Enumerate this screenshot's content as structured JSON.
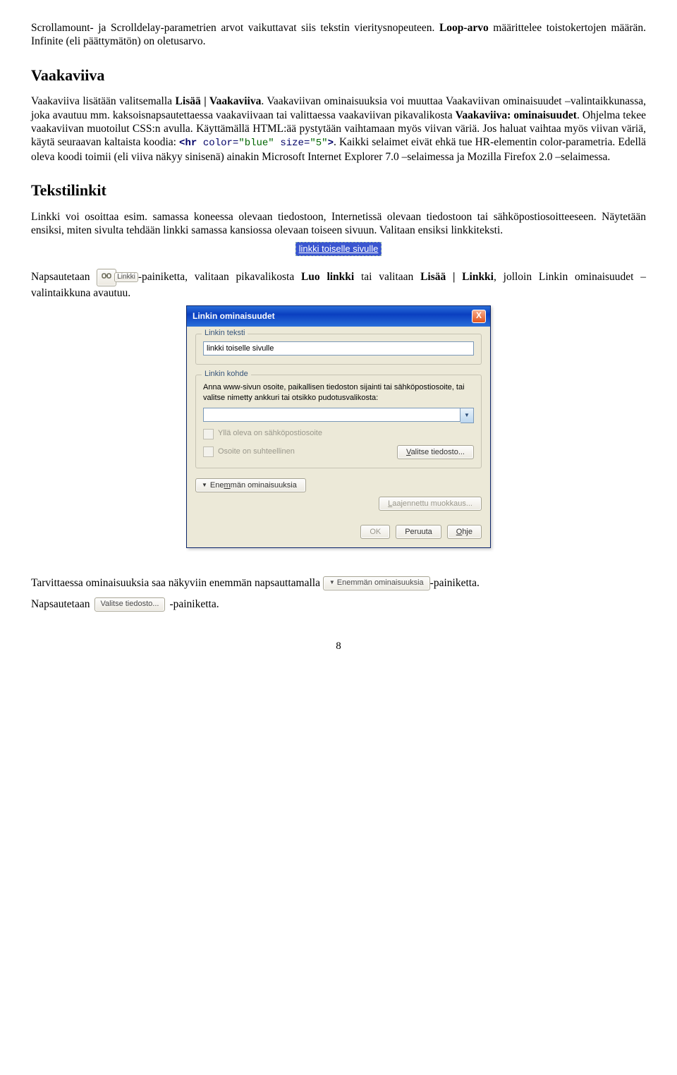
{
  "para1": {
    "t1": "Scrollamount- ja Scrolldelay-parametrien arvot vaikuttavat siis tekstin vieritysnopeuteen. ",
    "t2": "Loop-arvo",
    "t3": " määrittelee toistokertojen määrän. Infinite (eli päättymätön) on oletusarvo."
  },
  "heading_vaakaviiva": "Vaakaviiva",
  "para2": {
    "t1": "Vaakaviiva lisätään valitsemalla ",
    "t2": "Lisää | Vaakaviiva",
    "t3": ". Vaakaviivan ominaisuuksia voi muuttaa Vaakaviivan ominaisuudet –valintaikkunassa, joka avautuu mm. kaksoisnapsautettaessa vaakaviivaan tai valittaessa vaakaviivan pikavalikosta ",
    "t4": "Vaakaviiva: ominaisuudet",
    "t5": ". Ohjelma tekee vaakaviivan muotoilut CSS:n avulla. Käyttämällä HTML:ää pystytään vaihtamaan myös viivan väriä. Jos haluat vaihtaa myös viivan väriä, käytä seuraavan kaltaista koodia: ",
    "code_open": "<hr ",
    "code_attr1": "color=",
    "code_val1": "\"blue\"",
    "code_sp": " ",
    "code_attr2": "size=",
    "code_val2": "\"5\"",
    "code_close": ">",
    "t6": ". Kaikki selaimet eivät ehkä tue HR-elementin color-parametria. Edellä oleva koodi toimii (eli viiva näkyy sinisenä) ainakin Microsoft Internet Explorer 7.0 –selaimessa ja Mozilla Firefox 2.0 –selaimessa."
  },
  "heading_tekstilinkit": "Tekstilinkit",
  "para3": "Linkki voi osoittaa esim. samassa koneessa olevaan tiedostoon, Internetissä olevaan tiedostoon tai sähköpostiosoitteeseen. Näytetään ensiksi, miten sivulta tehdään linkki samassa kansiossa olevaan toiseen sivuun. Valitaan ensiksi linkkiteksti.",
  "highlight_text": "linkki toiselle sivulle",
  "para4": {
    "t1": "Napsautetaan ",
    "btn_label": "Linkki",
    "t2": "-painiketta, valitaan pikavalikosta ",
    "t3": "Luo linkki",
    "t4": " tai valitaan ",
    "t5": "Lisää | Linkki",
    "t6": ", jolloin Linkin ominaisuudet –valintaikkuna avautuu."
  },
  "dialog": {
    "title": "Linkin ominaisuudet",
    "close": "X",
    "group1_legend": "Linkin teksti",
    "group1_value": "linkki toiselle sivulle",
    "group2_legend": "Linkin kohde",
    "group2_help": "Anna www-sivun osoite, paikallisen tiedoston sijainti tai sähköpostiosoite, tai valitse nimetty ankkuri tai otsikko pudotusvalikosta:",
    "combo_value": "",
    "chk1": "Yllä oleva on sähköpostiosoite",
    "chk2": "Osoite on suhteellinen",
    "btn_browse": "Valitse tiedosto...",
    "btn_more": "Enemmän ominaisuuksia",
    "btn_advanced": "Laajennettu muokkaus...",
    "btn_ok": "OK",
    "btn_cancel": "Peruuta",
    "btn_help": "Ohje"
  },
  "para5": {
    "t1": "Tarvittaessa ominaisuuksia saa näkyviin enemmän napsauttamalla ",
    "btn_more": "Enemmän ominaisuuksia",
    "t2": "-painiketta.",
    "t3": "Napsautetaan ",
    "btn_browse": "Valitse tiedosto...",
    "t4": "-painiketta."
  },
  "page_number": "8"
}
